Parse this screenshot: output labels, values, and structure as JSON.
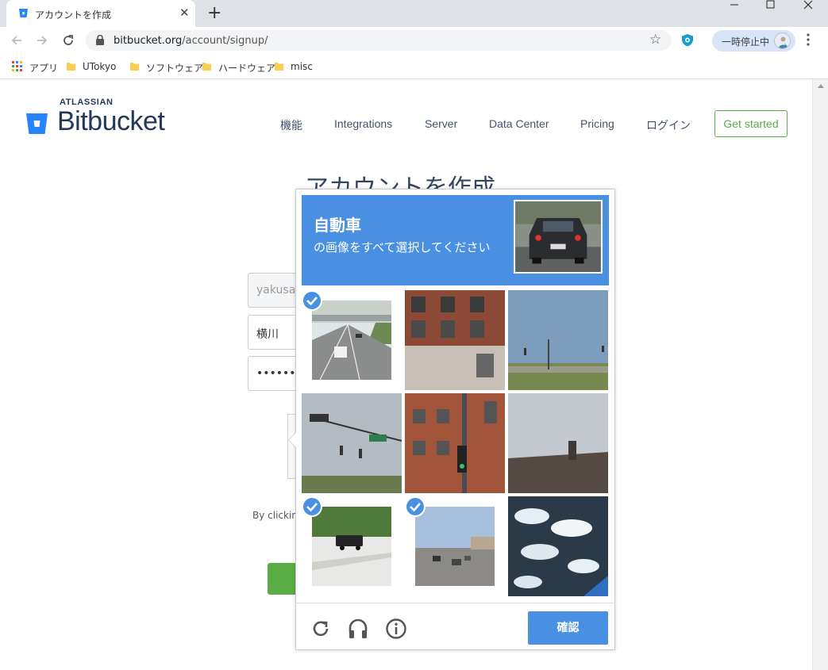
{
  "browser": {
    "tab_title": "アカウントを作成",
    "url_domain": "bitbucket.org",
    "url_path": "/account/signup/",
    "profile_label": "一時停止中",
    "bookmarks": [
      "アプリ",
      "UTokyo",
      "ソフトウェア",
      "ハードウェア",
      "misc"
    ]
  },
  "site": {
    "brand_parent": "ATLASSIAN",
    "brand_name": "Bitbucket",
    "nav": [
      "機能",
      "Integrations",
      "Server",
      "Data Center",
      "Pricing",
      "ログイン"
    ],
    "cta": "Get started",
    "heading": "アカウントを作成",
    "email_value": "yakusa",
    "name_value": "横川　",
    "password_value": "••••••••••",
    "terms_text": "By clicking",
    "colors": {
      "brand": "#253858",
      "accent_green": "#5aac44",
      "link": "#42526e"
    }
  },
  "captcha": {
    "title": "自動車",
    "subtitle": "の画像をすべて選択してください",
    "verify_label": "確認",
    "tiles": [
      {
        "scene": "highway-overpass",
        "selected": true
      },
      {
        "scene": "brick-building",
        "selected": false
      },
      {
        "scene": "field-traffic-pole",
        "selected": false
      },
      {
        "scene": "traffic-signal-sky",
        "selected": false
      },
      {
        "scene": "brick-building-traffic-light",
        "selected": false
      },
      {
        "scene": "rooftop-chimney",
        "selected": false
      },
      {
        "scene": "suv-on-road",
        "selected": true
      },
      {
        "scene": "intersection-cars",
        "selected": true
      },
      {
        "scene": "clouds-aerial",
        "selected": false
      }
    ],
    "colors": {
      "header": "#4a90e2",
      "button": "#4a90e2"
    },
    "icons": [
      "reload-icon",
      "audio-headphones-icon",
      "info-icon"
    ]
  }
}
